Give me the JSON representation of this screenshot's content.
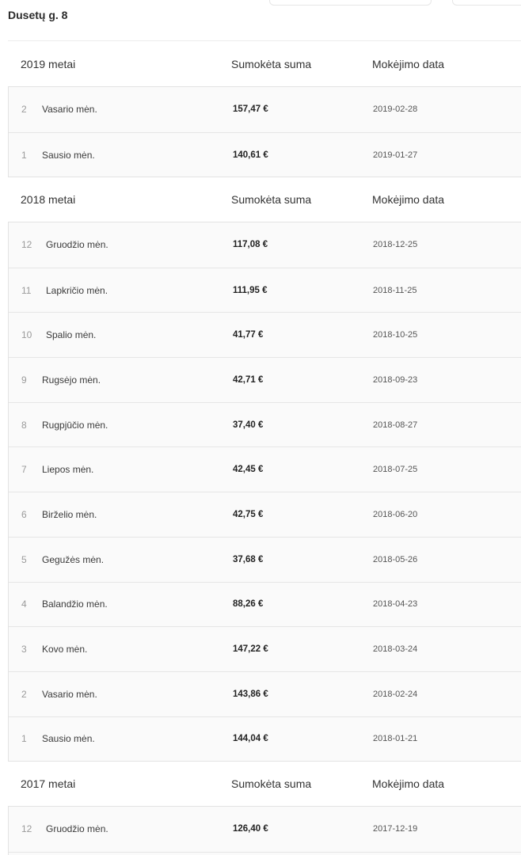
{
  "address": "Dusetų g. 8",
  "column_headers": {
    "amount": "Sumokėta suma",
    "date": "Mokėjimo data"
  },
  "years": [
    {
      "title": "2019 metai",
      "rows": [
        {
          "num": "2",
          "month": "Vasario mėn.",
          "amount": "157,47 €",
          "date": "2019-02-28"
        },
        {
          "num": "1",
          "month": "Sausio mėn.",
          "amount": "140,61 €",
          "date": "2019-01-27"
        }
      ]
    },
    {
      "title": "2018 metai",
      "rows": [
        {
          "num": "12",
          "month": "Gruodžio mėn.",
          "amount": "117,08 €",
          "date": "2018-12-25"
        },
        {
          "num": "11",
          "month": "Lapkričio mėn.",
          "amount": "111,95 €",
          "date": "2018-11-25"
        },
        {
          "num": "10",
          "month": "Spalio mėn.",
          "amount": "41,77 €",
          "date": "2018-10-25"
        },
        {
          "num": "9",
          "month": "Rugsėjo mėn.",
          "amount": "42,71 €",
          "date": "2018-09-23"
        },
        {
          "num": "8",
          "month": "Rugpjūčio mėn.",
          "amount": "37,40 €",
          "date": "2018-08-27"
        },
        {
          "num": "7",
          "month": "Liepos mėn.",
          "amount": "42,45 €",
          "date": "2018-07-25"
        },
        {
          "num": "6",
          "month": "Birželio mėn.",
          "amount": "42,75 €",
          "date": "2018-06-20"
        },
        {
          "num": "5",
          "month": "Gegužės mėn.",
          "amount": "37,68 €",
          "date": "2018-05-26"
        },
        {
          "num": "4",
          "month": "Balandžio mėn.",
          "amount": "88,26 €",
          "date": "2018-04-23"
        },
        {
          "num": "3",
          "month": "Kovo mėn.",
          "amount": "147,22 €",
          "date": "2018-03-24"
        },
        {
          "num": "2",
          "month": "Vasario mėn.",
          "amount": "143,86 €",
          "date": "2018-02-24"
        },
        {
          "num": "1",
          "month": "Sausio mėn.",
          "amount": "144,04 €",
          "date": "2018-01-21"
        }
      ]
    },
    {
      "title": "2017 metai",
      "rows": [
        {
          "num": "12",
          "month": "Gruodžio mėn.",
          "amount": "126,40 €",
          "date": "2017-12-19"
        }
      ]
    }
  ]
}
